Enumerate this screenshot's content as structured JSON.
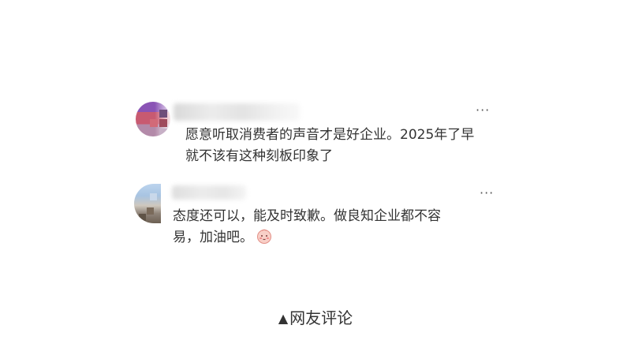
{
  "comments": [
    {
      "username": "",
      "text_line1": "愿意听取消费者的声音才是好企业。2025年了早",
      "text_line2": "就不该有这种刻板印象了",
      "more_icon": "more-icon"
    },
    {
      "username": "",
      "text_line1": "态度还可以，能及时致歉。做良知企业都不容",
      "text_line2": "易，加油吧。",
      "emoji": "blush-emoji-icon",
      "more_icon": "more-icon"
    }
  ],
  "footer": {
    "triangle": "▲",
    "caption": "网友评论"
  },
  "colors": {
    "text": "#333333",
    "background": "#ffffff",
    "more_icon": "#555555",
    "emoji_face": "#f6c0b8"
  }
}
